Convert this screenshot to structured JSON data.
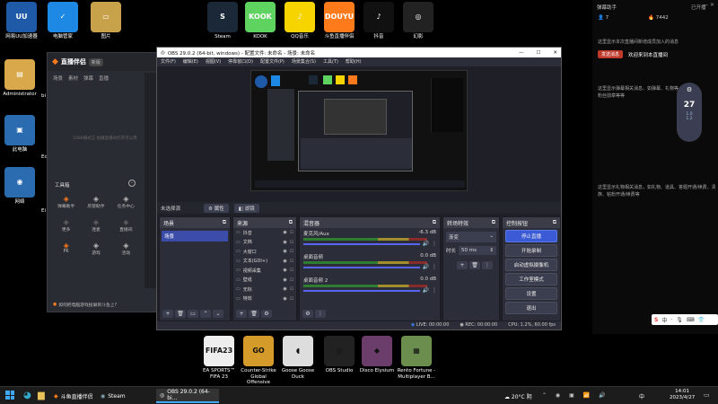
{
  "desktop": {
    "top_icons": [
      {
        "label": "网易UU加速器",
        "color": "#1e5aa8",
        "glyph": "UU"
      },
      {
        "label": "电脑管家",
        "color": "#1e88e5",
        "glyph": "✓"
      },
      {
        "label": "图片",
        "color": "#c8a24a",
        "glyph": "▭"
      },
      {
        "label": "Steam",
        "color": "#1b2838",
        "glyph": "S"
      },
      {
        "label": "KOOK",
        "color": "#5fd35f",
        "glyph": "KOOK"
      },
      {
        "label": "QQ音乐",
        "color": "#f5d400",
        "glyph": "♪"
      },
      {
        "label": "斗鱼直播伴侣",
        "color": "#ff7a1a",
        "glyph": "DOUYU"
      },
      {
        "label": "抖音",
        "color": "#111",
        "glyph": "♪"
      },
      {
        "label": "幻影",
        "color": "#222",
        "glyph": "◎"
      }
    ],
    "left_icons": [
      {
        "label": "Administrator",
        "color": "#d8a84a",
        "glyph": "▤"
      },
      {
        "label": "此电脑",
        "color": "#2b6cb0",
        "glyph": "▣"
      },
      {
        "label": "网络",
        "color": "#2b6cb0",
        "glyph": "◉"
      }
    ],
    "partial_left": [
      "bi",
      "Ed",
      "Ei"
    ],
    "bottom_icons": [
      {
        "label": "EA SPORTS™ FIFA 23",
        "color": "#eee",
        "glyph": "FIFA23"
      },
      {
        "label": "Counter-Strike Global Offensive",
        "color": "#d49a2a",
        "glyph": "GO"
      },
      {
        "label": "Goose Goose Duck",
        "color": "#ddd",
        "glyph": "◖"
      },
      {
        "label": "OBS Studio",
        "color": "#222",
        "glyph": "◎"
      },
      {
        "label": "Disco Elysium",
        "color": "#6a3d6a",
        "glyph": "◆"
      },
      {
        "label": "Rento Fortune - Multiplayer B...",
        "color": "#6b8e4e",
        "glyph": "▦"
      }
    ]
  },
  "douyu": {
    "title": "直播伴侣",
    "version_badge": "新版",
    "tabs": [
      "场景",
      "素材",
      "弹幕",
      "直播"
    ],
    "preview_hint": "1080横式正 拍摄直播间打开可以用",
    "toolbox_label": "工具箱",
    "tools": [
      "弹幕助手",
      "房管助手",
      "任务中心",
      "更多",
      "连麦",
      "直播间",
      "PK",
      "游戏",
      "活动"
    ],
    "footer": "如何把电脑游戏投屏到斗鱼上?"
  },
  "obs": {
    "window_title": "OBS 29.0.2 (64-bit, windows) - 配置文件: 未命名 - 场景: 未命名",
    "menu": [
      "文件(F)",
      "编辑(E)",
      "视图(V)",
      "停靠窗口(D)",
      "配置文件(P)",
      "场景集合(S)",
      "工具(T)",
      "帮助(H)"
    ],
    "no_source": "未选择源",
    "props_button": "属性",
    "filters_button": "滤镜",
    "scenes_title": "场景",
    "scene_item": "场景",
    "sources_title": "来源",
    "sources": [
      "抖音",
      "文档",
      "大窗口",
      "文本(GDI+)",
      "视频采集",
      "壁纸",
      "无标",
      "特效"
    ],
    "mixer_title": "混音器",
    "mixer": [
      {
        "name": "麦克风/Aux",
        "db": "-6.3 dB"
      },
      {
        "name": "桌面音频",
        "db": "0.0 dB"
      },
      {
        "name": "桌面音频 2",
        "db": "0.0 dB"
      }
    ],
    "transitions_title": "转场特效",
    "transition_type": "渐变",
    "duration_label": "时长",
    "duration_value": "50 ms",
    "controls_title": "控制按钮",
    "controls": [
      "停止直播",
      "开始录制",
      "启动虚拟摄像机",
      "工作室模式",
      "设置",
      "退出"
    ],
    "status_live": "LIVE: 00:00:00",
    "status_rec": "REC: 00:00:00",
    "status_cpu": "CPU: 1.2%, 60.00 fps"
  },
  "side_panel": {
    "title": "弹幕助手",
    "stats": [
      "7",
      "7442"
    ],
    "status": "已开播",
    "notice": "这里显示本次直播间新增成员加入的消息",
    "gift_button": "发送消息",
    "welcome": "欢迎来到本直播间",
    "msg1": "这里显示弹幕相关消息、如弹幕、礼物等，粉丝勋章等等",
    "msg2": "这里显示礼物相关消息，如礼物、道具、答题开通/续费、贵族、粘粉开通/续费等",
    "widget_temp": "27",
    "widget_l1": "1.0",
    "widget_l2": "1.2"
  },
  "taskbar": {
    "items": [
      "斗鱼直播伴侣",
      "Steam",
      "OBS 29.0.2 (64-bi..."
    ],
    "weather": "20°C 阴",
    "lang": "中",
    "time": "14:01",
    "date": "2023/4/27"
  }
}
